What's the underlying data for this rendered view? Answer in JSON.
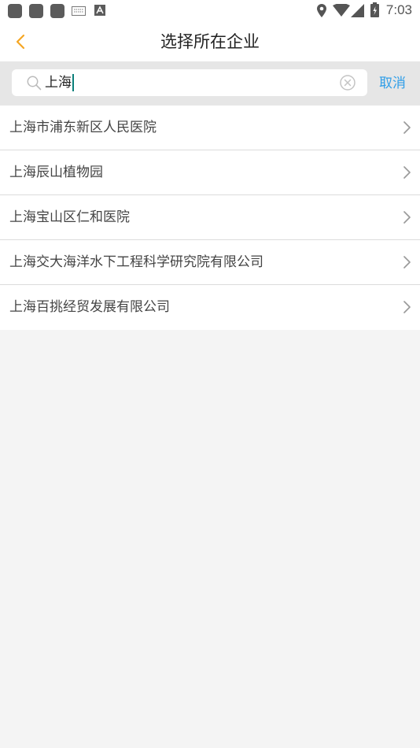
{
  "status_bar": {
    "time": "7:03"
  },
  "header": {
    "title": "选择所在企业",
    "back_icon": "chevron-left-icon",
    "accent_color": "#f5a623"
  },
  "search": {
    "value": "上海",
    "placeholder": "",
    "cancel_label": "取消",
    "cancel_color": "#2f9ee8"
  },
  "results": [
    {
      "label": "上海市浦东新区人民医院"
    },
    {
      "label": "上海辰山植物园"
    },
    {
      "label": "上海宝山区仁和医院"
    },
    {
      "label": "上海交大海洋水下工程科学研究院有限公司"
    },
    {
      "label": "上海百挑经贸发展有限公司"
    }
  ]
}
